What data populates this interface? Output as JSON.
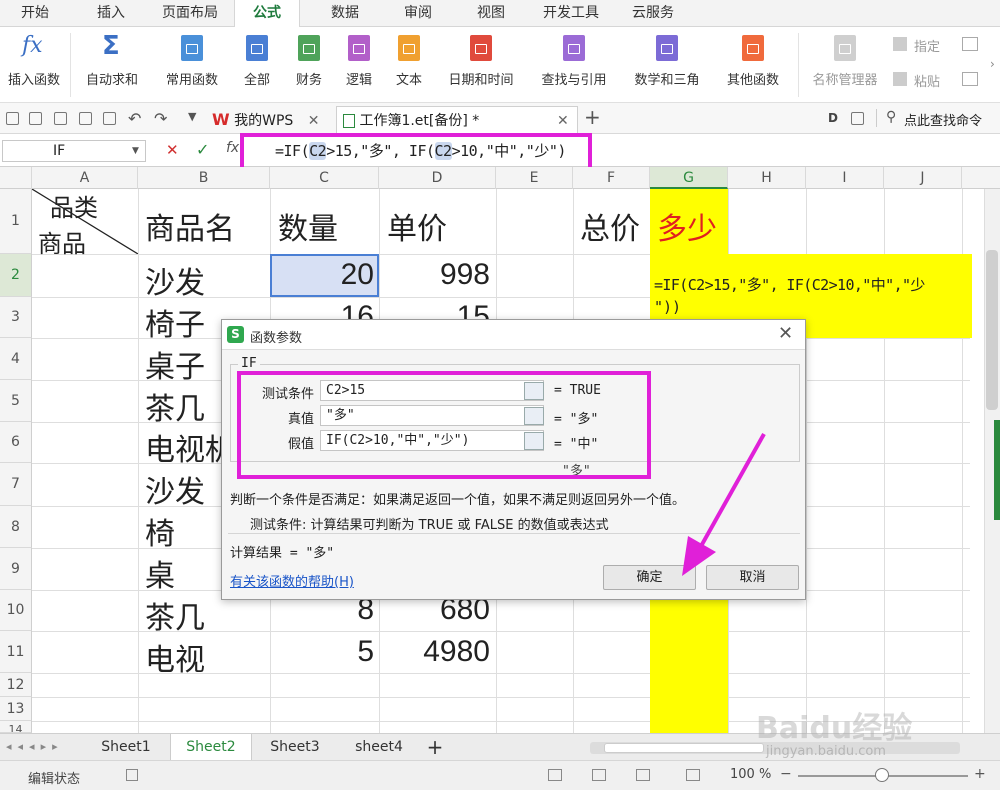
{
  "menu": {
    "tabs": [
      "开始",
      "插入",
      "页面布局",
      "公式",
      "数据",
      "审阅",
      "视图",
      "开发工具",
      "云服务"
    ],
    "active": "公式"
  },
  "ribbon": {
    "insert_func": "插入函数",
    "fx_glyph": "fx",
    "autosum": "自动求和",
    "sigma_glyph": "Σ",
    "common": "常用函数",
    "all": "全部",
    "finance": "财务",
    "logic": "逻辑",
    "text": "文本",
    "datetime": "日期和时间",
    "lookup": "查找与引用",
    "math": "数学和三角",
    "other": "其他函数",
    "name_mgr": "名称管理器",
    "specify": "指定",
    "paste": "粘贴",
    "colors": {
      "common": "#4a90d9",
      "all": "#4a7fd4",
      "finance": "#4fa35a",
      "logic": "#b25fc9",
      "text": "#f0a030",
      "datetime": "#e04a3c",
      "lookup": "#9b6bd6",
      "math": "#7c6bd6",
      "other": "#f06a3c"
    }
  },
  "quickbar": {
    "wps_tab": "我的WPS",
    "file_tab": "工作簿1.et[备份] *",
    "search_cmd": "点此查找命令",
    "plus": "+"
  },
  "formula_bar": {
    "name_box": "IF",
    "fx": "fx",
    "parts": [
      "=IF(",
      "C2",
      ">15,\"多\", IF(",
      "C2",
      ">10,\"中\",\"少\")"
    ]
  },
  "columns": [
    "A",
    "B",
    "C",
    "D",
    "E",
    "F",
    "G",
    "H",
    "I",
    "J"
  ],
  "rows": [
    "1",
    "2",
    "3",
    "4",
    "5",
    "6",
    "7",
    "8",
    "9",
    "10",
    "11",
    "12",
    "13",
    "14"
  ],
  "header_row": {
    "a_top": "品类",
    "a_bottom": "商品",
    "b": "商品名",
    "c": "数量",
    "d": "单价",
    "f": "总价",
    "g": "多少"
  },
  "products": [
    "沙发",
    "椅子",
    "桌子",
    "茶几",
    "电视机",
    "沙发",
    "椅",
    "桌",
    "茶几",
    "电视"
  ],
  "quantities": [
    "20",
    "16",
    "",
    "",
    "",
    "",
    "",
    "",
    "8",
    "5"
  ],
  "prices": [
    "998",
    "15",
    "",
    "",
    "",
    "",
    "",
    "",
    "680",
    "4980"
  ],
  "g2_formula_line1": "=IF(C2>15,\"多\", IF(C2>10,\"中\",\"少",
  "g2_formula_line2": "\"))",
  "dialog": {
    "title": "函数参数",
    "func_name": "IF",
    "args": [
      {
        "label": "测试条件",
        "value": "C2>15",
        "result": "= TRUE"
      },
      {
        "label": "真值",
        "value": "\"多\"",
        "result": "= \"多\""
      },
      {
        "label": "假值",
        "value": "IF(C2>10,\"中\",\"少\")",
        "result": "= \"中\""
      }
    ],
    "overall": "\"多\"",
    "description": "判断一个条件是否满足：如果满足返回一个值，如果不满足则返回另外一个值。",
    "arg_help": "测试条件:  计算结果可判断为 TRUE 或 FALSE 的数值或表达式",
    "calc_result": "计算结果 = \"多\"",
    "help_link": "有关该函数的帮助(H)",
    "ok": "确定",
    "cancel": "取消"
  },
  "sheets": {
    "tabs": [
      "Sheet1",
      "Sheet2",
      "Sheet3",
      "sheet4"
    ],
    "active": "Sheet2",
    "add": "+"
  },
  "status": {
    "mode": "编辑状态",
    "zoom": "100 %"
  },
  "watermark": {
    "brand": "Baidu经验",
    "url": "jingyan.baidu.com"
  }
}
